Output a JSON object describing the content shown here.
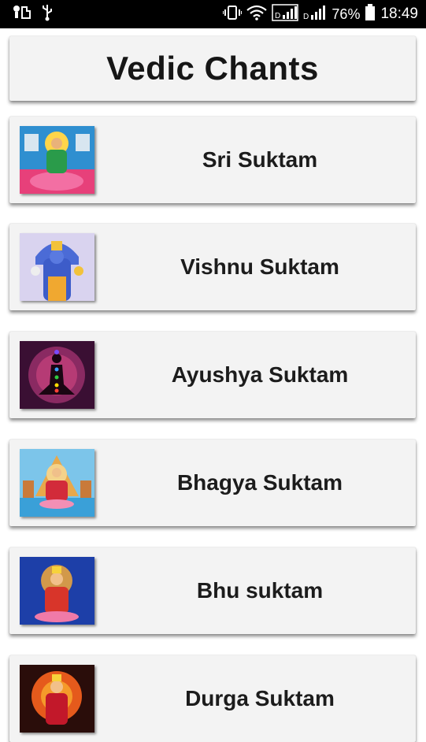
{
  "status_bar": {
    "battery_percent": "76%",
    "time": "18:49",
    "icons": [
      "usb-debug-icon",
      "usb-icon",
      "vibrate-icon",
      "wifi-icon",
      "signal-sim1-icon",
      "signal-sim2-icon",
      "battery-icon"
    ]
  },
  "header": {
    "title": "Vedic Chants"
  },
  "chants": [
    {
      "label": "Sri Suktam",
      "image": "lakshmi-image"
    },
    {
      "label": "Vishnu Suktam",
      "image": "vishnu-image"
    },
    {
      "label": "Ayushya Suktam",
      "image": "chakra-meditation-image"
    },
    {
      "label": "Bhagya Suktam",
      "image": "lakshmi-temple-image"
    },
    {
      "label": "Bhu suktam",
      "image": "bhudevi-image"
    },
    {
      "label": "Durga Suktam",
      "image": "durga-image"
    }
  ]
}
